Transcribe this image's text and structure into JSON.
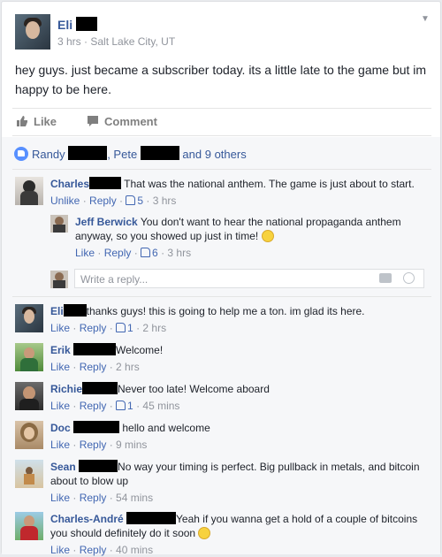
{
  "post": {
    "author": "Eli",
    "time": "3 hrs",
    "location": "Salt Lake City, UT",
    "meta_sep": " · ",
    "text": "hey guys. just became a subscriber today. its a little late to the game but im happy to be here."
  },
  "actions": {
    "like": "Like",
    "comment": "Comment"
  },
  "likes_summary": {
    "name1": "Randy",
    "name2": ", Pete",
    "others": "and 9 others"
  },
  "comments": [
    {
      "name": "Charles",
      "text": "That was the national anthem. The game is just about to start.",
      "likes": "5",
      "time": "3 hrs"
    },
    {
      "name": "Jeff Berwick",
      "text": "You don't want to hear the national propaganda anthem anyway, so you showed up just in time!",
      "likes": "6",
      "time": "3 hrs"
    },
    {
      "name": "Eli",
      "text": "thanks guys! this is going to help me a ton. im glad its here.",
      "likes": "1",
      "time": "2 hrs"
    },
    {
      "name": "Erik",
      "text": "Welcome!",
      "time": "2 hrs"
    },
    {
      "name": "Richie",
      "text": "Never too late! Welcome aboard",
      "likes": "1",
      "time": "45 mins"
    },
    {
      "name": "Doc",
      "text": "hello and welcome",
      "time": "9 mins"
    },
    {
      "name": "Sean",
      "text": "No way your timing is perfect. Big pullback in metals, and bitcoin about to blow up",
      "time": "54 mins"
    },
    {
      "name": "Charles-André",
      "text": "Yeah if you wanna get a hold of a couple of bitcoins you should definitely do it soon",
      "time": "40 mins"
    }
  ],
  "comment_actions": {
    "unlike": "Unlike",
    "like": "Like",
    "reply": "Reply",
    "sep": " · "
  },
  "reply_placeholder": "Write a reply...",
  "colors": {
    "link": "#365899",
    "accent": "#4267b2",
    "meta": "#90949c"
  }
}
